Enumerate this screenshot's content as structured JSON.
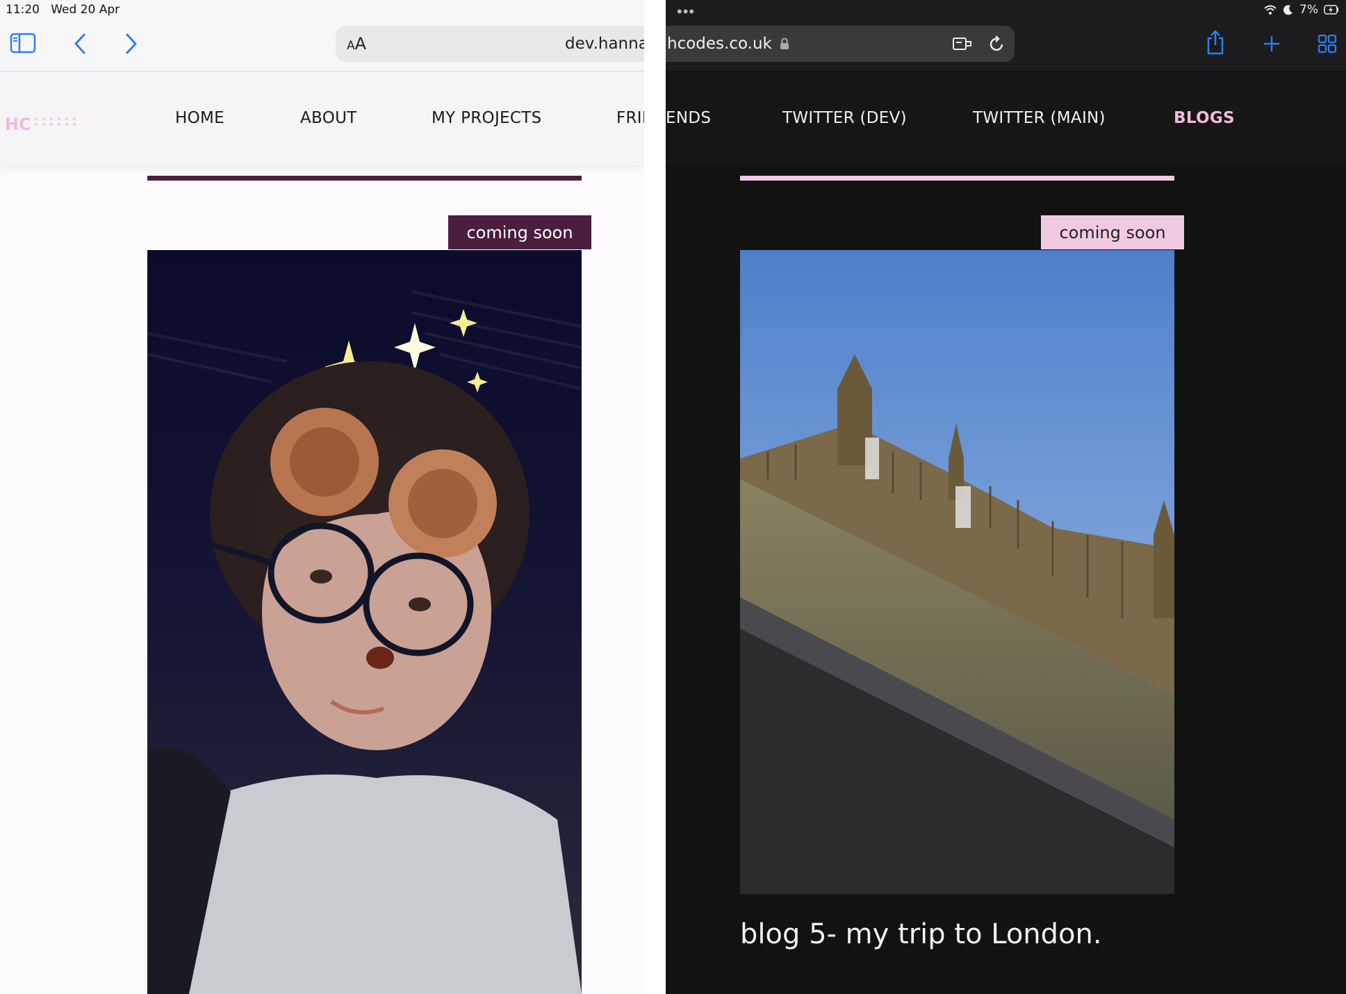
{
  "left": {
    "status": {
      "time": "11:20",
      "date": "Wed 20 Apr"
    },
    "url_prefix": "dev.hannal",
    "aa_small": "A",
    "aa_large": "A",
    "logo": "HC",
    "nav": [
      "HOME",
      "ABOUT",
      "MY PROJECTS",
      "FRIE"
    ],
    "badge": "coming soon"
  },
  "right": {
    "more_dots": "•••",
    "status": {
      "battery": "7%"
    },
    "url_suffix": "hcodes.co.uk",
    "nav": [
      "ENDS",
      "TWITTER (DEV)",
      "TWITTER (MAIN)",
      "BLOGS"
    ],
    "badge": "coming soon",
    "blog_title": "blog 5- my trip to London."
  },
  "colors": {
    "accent_dark": "#4b1d3f",
    "accent_pink": "#f2c9e3",
    "logo_pink": "#f2b8dc"
  },
  "icons": [
    "sidebar-icon",
    "back-icon",
    "forward-icon",
    "lock-icon",
    "reader-icon",
    "reload-icon",
    "share-icon",
    "plus-icon",
    "tabs-grid-icon",
    "wifi-icon",
    "moon-icon",
    "battery-icon"
  ]
}
